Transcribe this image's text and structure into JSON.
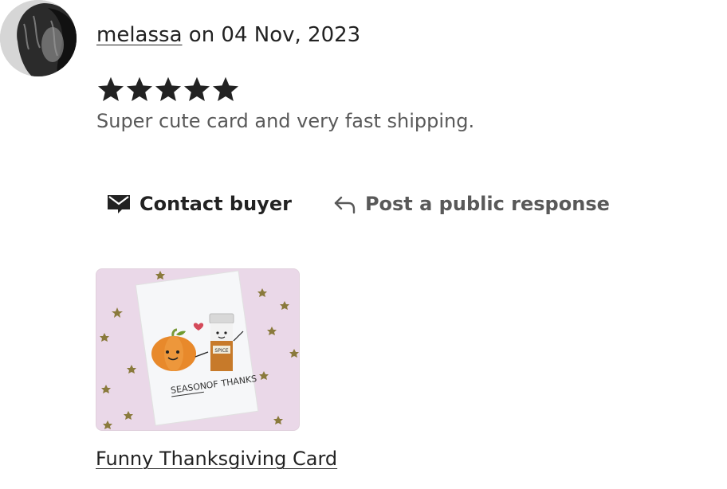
{
  "review": {
    "username": "melassa",
    "date_text": " on 04 Nov, 2023",
    "rating": 5,
    "rating_max": 5,
    "text": "Super cute card and very fast shipping."
  },
  "actions": {
    "contact_label": "Contact buyer",
    "respond_label": "Post a public response"
  },
  "product": {
    "title": "Funny Thanksgiving Card",
    "card_text_1": "SEASON",
    "card_text_2": "OF",
    "card_text_3": "THANKS",
    "jar_label": "SPICE"
  },
  "colors": {
    "text": "#222222",
    "muted": "#595959",
    "thumb_bg": "#ead8e8",
    "pumpkin": "#e8892b",
    "star_gold": "#8a7a3c"
  }
}
